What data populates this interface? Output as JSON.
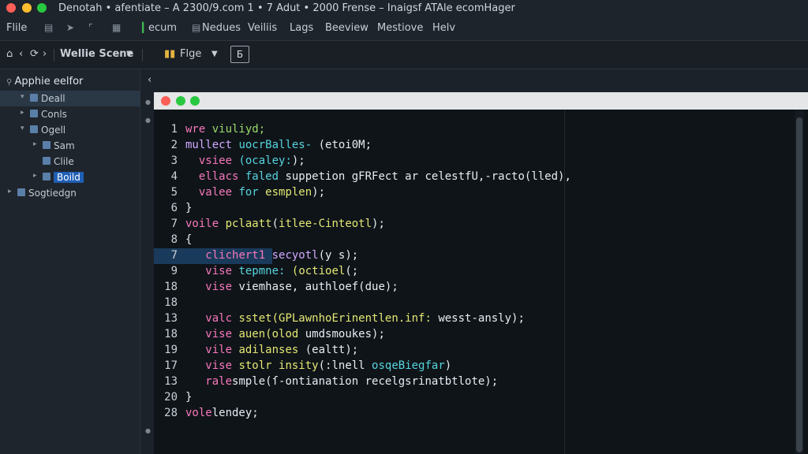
{
  "window": {
    "title": "Denotah • afentiate – A 2300/9.com   1 • 7  Adut • 2000 Frense  –  Inaigsf ATAle ecomHager"
  },
  "menu": {
    "items": [
      "Flile",
      "ecum",
      "Nedues",
      "Veiliis",
      "Lags",
      "Beeview",
      "Mestiove",
      "Helv"
    ]
  },
  "toolbar": {
    "scheme_label": "Wellie Scene",
    "pages_label": "Flge",
    "box_label": "Б"
  },
  "sidebar": {
    "header": "Apphie eelfor",
    "items": [
      {
        "label": "Deall",
        "indent": 1,
        "arrow": "▾"
      },
      {
        "label": "Conls",
        "indent": 1,
        "arrow": "▸"
      },
      {
        "label": "Ogell",
        "indent": 1,
        "arrow": "▾"
      },
      {
        "label": "Sam",
        "indent": 2,
        "arrow": "▸"
      },
      {
        "label": "Clile",
        "indent": 2,
        "arrow": ""
      },
      {
        "label": "Boild",
        "indent": 2,
        "arrow": "▸"
      },
      {
        "label": "Sogtiedgn",
        "indent": 0,
        "arrow": "▸"
      }
    ]
  },
  "colors": {
    "keyword": "#f778ba",
    "function": "#d2a8ff",
    "type": "#56d4dd",
    "string": "#e3e873",
    "selection": "#1f5fb5"
  },
  "code": {
    "lines": [
      {
        "num": "1",
        "segs": [
          [
            "kw",
            "wre "
          ],
          [
            "gr",
            "viuliyd;"
          ]
        ]
      },
      {
        "num": "2",
        "segs": [
          [
            "fn",
            "mullect "
          ],
          [
            "ty",
            "uocrBalles- "
          ],
          [
            "pl",
            "(etoi0M;"
          ]
        ]
      },
      {
        "num": "3",
        "segs": [
          [
            "pl",
            "  "
          ],
          [
            "kw",
            "vsiee "
          ],
          [
            "ty",
            "(ocaley:"
          ],
          [
            "pl",
            ");"
          ]
        ]
      },
      {
        "num": "4",
        "segs": [
          [
            "pl",
            "  "
          ],
          [
            "kw",
            "ellacs "
          ],
          [
            "ty",
            "faled "
          ],
          [
            "pl",
            "suppetion gFRFect ar celestfU,-racto(lled),"
          ]
        ]
      },
      {
        "num": "5",
        "segs": [
          [
            "pl",
            "  "
          ],
          [
            "kw",
            "valee "
          ],
          [
            "ty",
            "for "
          ],
          [
            "st",
            "esmplen"
          ],
          [
            "pl",
            ");"
          ]
        ]
      },
      {
        "num": "6",
        "segs": [
          [
            "pl",
            "}"
          ]
        ]
      },
      {
        "num": "7",
        "segs": [
          [
            "kw",
            "voile "
          ],
          [
            "st",
            "pclaatt"
          ],
          [
            "pl",
            "("
          ],
          [
            "st",
            "itlee-Cinteotl"
          ],
          [
            "pl",
            ");"
          ]
        ]
      },
      {
        "num": "8",
        "segs": [
          [
            "pl",
            "{"
          ]
        ]
      },
      {
        "num": "7",
        "segs": [
          [
            "pl",
            "   "
          ],
          [
            "kw",
            "clichert1 "
          ],
          [
            "fn",
            "secyotl"
          ],
          [
            "pl",
            "(y s);"
          ]
        ],
        "hl": true
      },
      {
        "num": "9",
        "segs": [
          [
            "pl",
            "   "
          ],
          [
            "kw",
            "vise "
          ],
          [
            "ty",
            "tepmne: "
          ],
          [
            "st",
            "(octioel"
          ],
          [
            "pl",
            "(;"
          ]
        ]
      },
      {
        "num": "18",
        "segs": [
          [
            "pl",
            "   "
          ],
          [
            "kw",
            "vise "
          ],
          [
            "pl",
            "viemhase, authloef(due);"
          ]
        ]
      },
      {
        "num": "18",
        "segs": []
      },
      {
        "num": "13",
        "segs": [
          [
            "pl",
            "   "
          ],
          [
            "kw",
            "valc "
          ],
          [
            "st",
            "sstet(GPLawnhoErinentlen.inf: "
          ],
          [
            "pl",
            "wesst-ansly);"
          ]
        ]
      },
      {
        "num": "18",
        "segs": [
          [
            "pl",
            "   "
          ],
          [
            "kw",
            "vise "
          ],
          [
            "st",
            "auen(olod "
          ],
          [
            "pl",
            "umdsmoukes);"
          ]
        ]
      },
      {
        "num": "19",
        "segs": [
          [
            "pl",
            "   "
          ],
          [
            "kw",
            "vile "
          ],
          [
            "st",
            "adilanses "
          ],
          [
            "pl",
            "(ealtt);"
          ]
        ]
      },
      {
        "num": "17",
        "segs": [
          [
            "pl",
            "   "
          ],
          [
            "kw",
            "vise "
          ],
          [
            "st",
            "stolr insity"
          ],
          [
            "pl",
            "(:lnell "
          ],
          [
            "ty",
            "osqeBiegfar"
          ],
          [
            "pl",
            ")"
          ]
        ]
      },
      {
        "num": "13",
        "segs": [
          [
            "pl",
            "   "
          ],
          [
            "kw",
            "rale"
          ],
          [
            "pl",
            "smple(ſ-ontianation recelgsrinatbtlote);"
          ]
        ]
      },
      {
        "num": "20",
        "segs": [
          [
            "pl",
            "}"
          ]
        ]
      },
      {
        "num": "28",
        "segs": [
          [
            "kw",
            "vole"
          ],
          [
            "pl",
            "lendey;"
          ]
        ]
      }
    ]
  }
}
